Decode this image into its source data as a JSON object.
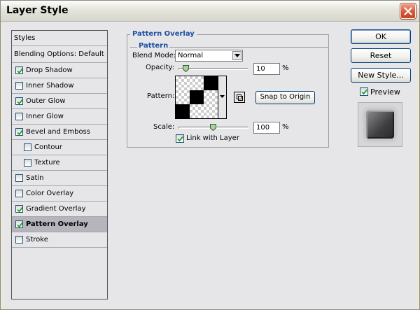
{
  "window": {
    "title": "Layer Style"
  },
  "styles_list": {
    "header": "Styles",
    "blending": "Blending Options: Default",
    "items": [
      {
        "label": "Drop Shadow",
        "checked": true,
        "indent": false,
        "selected": false
      },
      {
        "label": "Inner Shadow",
        "checked": false,
        "indent": false,
        "selected": false
      },
      {
        "label": "Outer Glow",
        "checked": true,
        "indent": false,
        "selected": false
      },
      {
        "label": "Inner Glow",
        "checked": false,
        "indent": false,
        "selected": false
      },
      {
        "label": "Bevel and Emboss",
        "checked": true,
        "indent": false,
        "selected": false
      },
      {
        "label": "Contour",
        "checked": false,
        "indent": true,
        "selected": false
      },
      {
        "label": "Texture",
        "checked": false,
        "indent": true,
        "selected": false
      },
      {
        "label": "Satin",
        "checked": false,
        "indent": false,
        "selected": false
      },
      {
        "label": "Color Overlay",
        "checked": false,
        "indent": false,
        "selected": false
      },
      {
        "label": "Gradient Overlay",
        "checked": true,
        "indent": false,
        "selected": false
      },
      {
        "label": "Pattern Overlay",
        "checked": true,
        "indent": false,
        "selected": true
      },
      {
        "label": "Stroke",
        "checked": false,
        "indent": false,
        "selected": false
      }
    ]
  },
  "panel": {
    "title": "Pattern Overlay",
    "subtitle": "Pattern",
    "blend_mode": {
      "label": "Blend Mode:",
      "value": "Normal"
    },
    "opacity": {
      "label": "Opacity:",
      "value": "10",
      "unit": "%",
      "percent": 10
    },
    "pattern": {
      "label": "Pattern:"
    },
    "snap_button": "Snap to Origin",
    "scale": {
      "label": "Scale:",
      "value": "100",
      "unit": "%",
      "percent": 100
    },
    "link_with_layer": {
      "label": "Link with Layer",
      "checked": true
    }
  },
  "buttons": {
    "ok": "OK",
    "reset": "Reset",
    "new_style": "New Style..."
  },
  "preview": {
    "label": "Preview",
    "checked": true
  },
  "colors": {
    "title_blue": "#1A4FA0",
    "selection": "#B5B6BB",
    "close_red": "#D9573A"
  }
}
